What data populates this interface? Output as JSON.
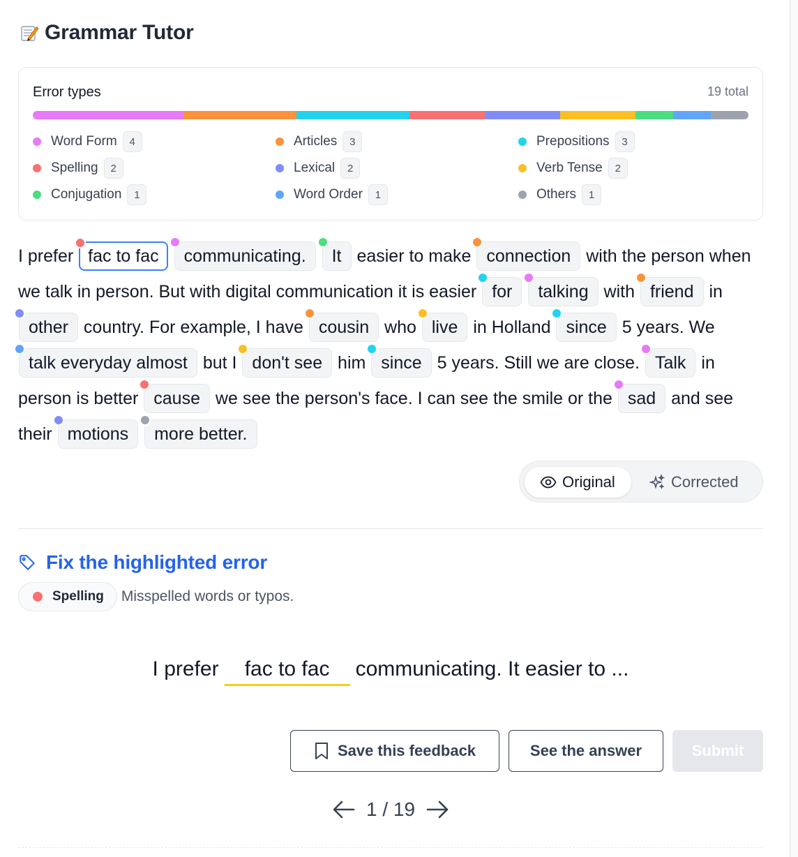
{
  "header": {
    "title": "Grammar Tutor",
    "icon": "memo-pencil-icon"
  },
  "error_types": {
    "title": "Error types",
    "total_label": "19 total",
    "types": [
      {
        "label": "Word Form",
        "count": "4",
        "color": "#e879f9"
      },
      {
        "label": "Articles",
        "count": "3",
        "color": "#fb923c"
      },
      {
        "label": "Prepositions",
        "count": "3",
        "color": "#22d3ee"
      },
      {
        "label": "Spelling",
        "count": "2",
        "color": "#f87171"
      },
      {
        "label": "Lexical",
        "count": "2",
        "color": "#818cf8"
      },
      {
        "label": "Verb Tense",
        "count": "2",
        "color": "#fbbf24"
      },
      {
        "label": "Conjugation",
        "count": "1",
        "color": "#4ade80"
      },
      {
        "label": "Word Order",
        "count": "1",
        "color": "#60a5fa"
      },
      {
        "label": "Others",
        "count": "1",
        "color": "#9ca3af"
      }
    ]
  },
  "essay": {
    "segments": [
      {
        "t": "I prefer "
      },
      {
        "e": "fac to fac",
        "c": "#f87171",
        "active": true
      },
      {
        "t": " "
      },
      {
        "e": "communicating.",
        "c": "#e879f9"
      },
      {
        "t": " "
      },
      {
        "e": "It",
        "c": "#4ade80"
      },
      {
        "t": " easier to make "
      },
      {
        "e": "connection",
        "c": "#fb923c"
      },
      {
        "t": " with the person when we talk in person. But with digital communication it is easier "
      },
      {
        "e": "for",
        "c": "#22d3ee"
      },
      {
        "t": " "
      },
      {
        "e": "talking",
        "c": "#e879f9"
      },
      {
        "t": " with "
      },
      {
        "e": "friend",
        "c": "#fb923c"
      },
      {
        "t": " in "
      },
      {
        "e": "other",
        "c": "#818cf8"
      },
      {
        "t": " country. For example, I have "
      },
      {
        "e": "cousin",
        "c": "#fb923c"
      },
      {
        "t": " who "
      },
      {
        "e": "live",
        "c": "#fbbf24"
      },
      {
        "t": " in Holland "
      },
      {
        "e": "since",
        "c": "#22d3ee"
      },
      {
        "t": " 5 years. We "
      },
      {
        "e": "talk everyday almost",
        "c": "#60a5fa"
      },
      {
        "t": " but I "
      },
      {
        "e": "don't see",
        "c": "#fbbf24"
      },
      {
        "t": " him "
      },
      {
        "e": "since",
        "c": "#22d3ee"
      },
      {
        "t": " 5 years. Still we are close. "
      },
      {
        "e": "Talk",
        "c": "#e879f9"
      },
      {
        "t": " in person is better "
      },
      {
        "e": "cause",
        "c": "#f87171"
      },
      {
        "t": " we see the person's face. I can see the smile or the "
      },
      {
        "e": "sad",
        "c": "#e879f9"
      },
      {
        "t": " and see their "
      },
      {
        "e": "motions",
        "c": "#818cf8"
      },
      {
        "t": " "
      },
      {
        "e": "more better.",
        "c": "#9ca3af"
      }
    ]
  },
  "view_toggle": {
    "original_label": "Original",
    "corrected_label": "Corrected",
    "selected": "Original"
  },
  "fix": {
    "title": "Fix the highlighted error",
    "type_label": "Spelling",
    "type_color": "#f87171",
    "type_description": "Misspelled words or typos.",
    "sentence_before": "I prefer",
    "sentence_gap": "fac to fac",
    "sentence_after": "communicating. It easier to ..."
  },
  "actions": {
    "save_label": "Save this feedback",
    "answer_label": "See the answer",
    "submit_label": "Submit"
  },
  "pager": {
    "text": "1 / 19"
  }
}
